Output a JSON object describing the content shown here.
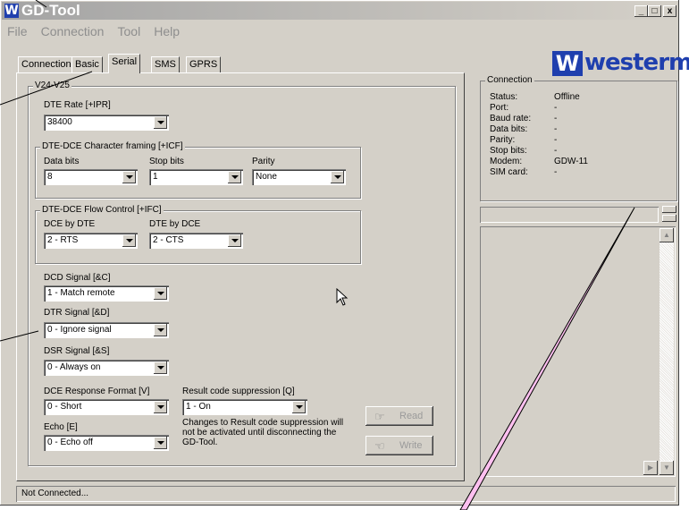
{
  "app": {
    "title": "GD-Tool",
    "title_logo_letter": "W"
  },
  "window_buttons": [
    "_",
    "□",
    "x"
  ],
  "menu": [
    "File",
    "Connection",
    "Tool",
    "Help"
  ],
  "tabs": [
    "Connection",
    "Basic",
    "Serial",
    "SMS",
    "GPRS"
  ],
  "active_tab": "Serial",
  "serial": {
    "v24_label": "V24-V25",
    "dte_rate_label": "DTE Rate [+IPR]",
    "dte_rate_value": "38400",
    "framing": {
      "group_label": "DTE-DCE Character framing [+ICF]",
      "data_bits_label": "Data bits",
      "data_bits_value": "8",
      "stop_bits_label": "Stop bits",
      "stop_bits_value": "1",
      "parity_label": "Parity",
      "parity_value": "None"
    },
    "flow": {
      "group_label": "DTE-DCE Flow Control [+IFC]",
      "dce_by_dte_label": "DCE by DTE",
      "dce_by_dte_value": "2 - RTS",
      "dte_by_dce_label": "DTE by DCE",
      "dte_by_dce_value": "2 - CTS"
    },
    "dcd_label": "DCD Signal [&C]",
    "dcd_value": "1 - Match remote",
    "dtr_label": "DTR Signal [&D]",
    "dtr_value": "0 - Ignore signal",
    "dsr_label": "DSR Signal [&S]",
    "dsr_value": "0 - Always on",
    "response_format_label": "DCE Response Format [V]",
    "response_format_value": "0 - Short",
    "result_suppression_label": "Result code suppression [Q]",
    "result_suppression_value": "1 - On",
    "echo_label": "Echo [E]",
    "echo_value": "0 - Echo off",
    "note": "Changes to Result code suppression will not be activated until disconnecting the GD-Tool.",
    "read_button": "Read",
    "write_button": "Write"
  },
  "brand": {
    "name": "westermo",
    "mark": "W"
  },
  "connection": {
    "group_label": "Connection",
    "rows": [
      {
        "label": "Status:",
        "value": "Offline"
      },
      {
        "label": "Port:",
        "value": "-"
      },
      {
        "label": "Baud rate:",
        "value": "-"
      },
      {
        "label": "Data bits:",
        "value": "-"
      },
      {
        "label": "Parity:",
        "value": "-"
      },
      {
        "label": "Stop bits:",
        "value": "-"
      },
      {
        "label": "Modem:",
        "value": "GDW-11"
      },
      {
        "label": "SIM card:",
        "value": "-"
      }
    ]
  },
  "statusbar": {
    "text": "Not Connected..."
  },
  "colors": {
    "accent": "#1f3fae",
    "callout": "#ffc0f0",
    "chrome": "#d4d0c8"
  },
  "icons": [
    "read-icon",
    "write-icon",
    "mouse-pointer-icon"
  ]
}
